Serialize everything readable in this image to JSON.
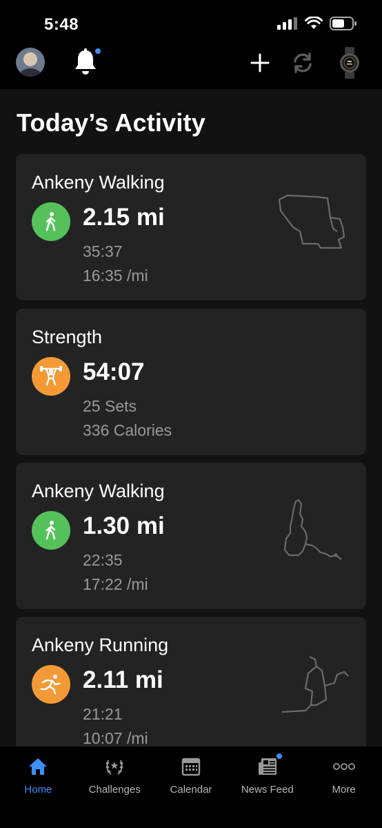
{
  "status_bar": {
    "time": "5:48"
  },
  "page": {
    "title": "Today’s Activity"
  },
  "activities": [
    {
      "title": "Ankeny Walking",
      "primary": "2.15 mi",
      "secondary1": "35:37",
      "secondary2": "16:35 /mi",
      "icon": "walking-icon",
      "color": "#55c15a"
    },
    {
      "title": "Strength",
      "primary": "54:07",
      "secondary1": "25 Sets",
      "secondary2": "336 Calories",
      "icon": "weightlifting-icon",
      "color": "#f39a36"
    },
    {
      "title": "Ankeny Walking",
      "primary": "1.30 mi",
      "secondary1": "22:35",
      "secondary2": "17:22 /mi",
      "icon": "walking-icon",
      "color": "#55c15a"
    },
    {
      "title": "Ankeny Running",
      "primary": "2.11 mi",
      "secondary1": "21:21",
      "secondary2": "10:07 /mi",
      "icon": "running-icon",
      "color": "#f39a36"
    }
  ],
  "tabs": [
    {
      "label": "Home",
      "icon": "home-icon",
      "active": true
    },
    {
      "label": "Challenges",
      "icon": "laurel-icon",
      "active": false
    },
    {
      "label": "Calendar",
      "icon": "calendar-icon",
      "active": false
    },
    {
      "label": "News Feed",
      "icon": "newspaper-icon",
      "active": false
    },
    {
      "label": "More",
      "icon": "more-dots-icon",
      "active": false
    }
  ],
  "colors": {
    "accent": "#3f8ef7",
    "walk": "#55c15a",
    "strength": "#f39a36"
  }
}
